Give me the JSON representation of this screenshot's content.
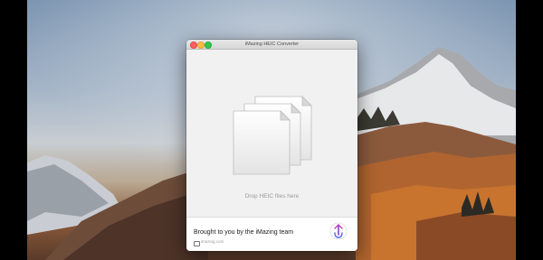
{
  "window": {
    "title": "iMazing HEIC Converter",
    "drop_label": "Drop HEIC files here"
  },
  "footer": {
    "title": "Brought to you by the iMazing team",
    "link": "imazing.com",
    "logo_icon": "imazing-logo-icon"
  },
  "colors": {
    "close": "#fc605c",
    "minimize": "#fdbc40",
    "maximize": "#34c84a",
    "logo_purple": "#8a3fd1"
  }
}
